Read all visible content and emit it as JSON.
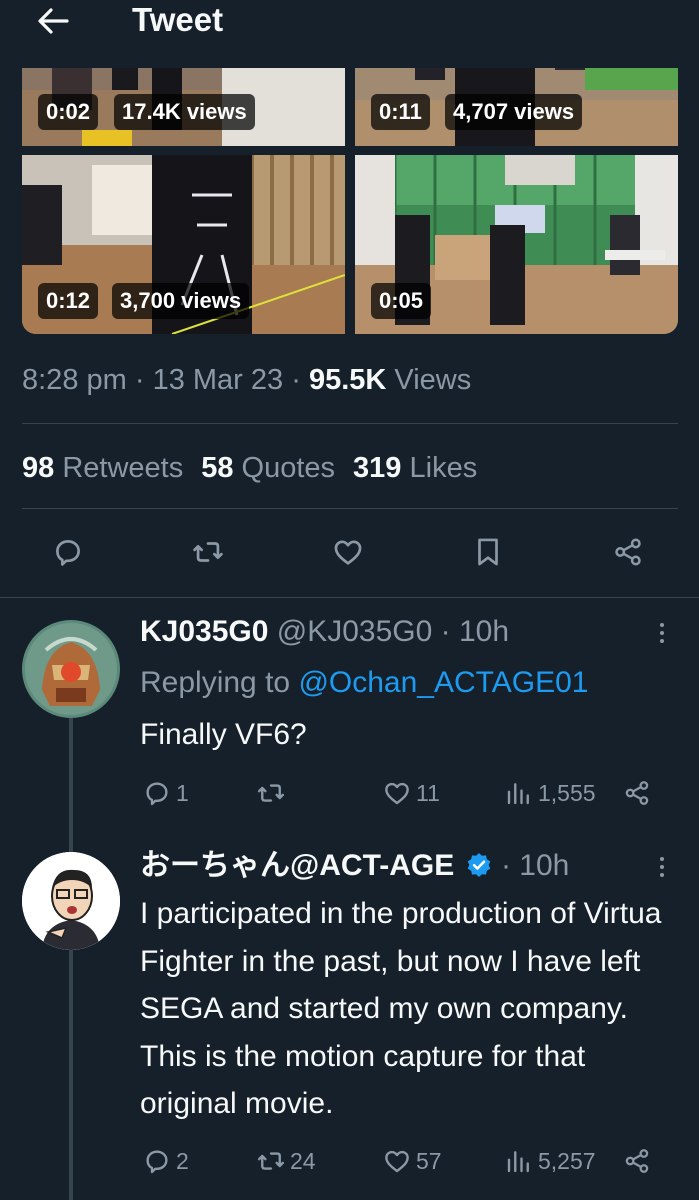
{
  "header": {
    "title": "Tweet",
    "back_icon": "arrow-left-icon"
  },
  "media": [
    {
      "duration": "0:02",
      "views": "17.4K views"
    },
    {
      "duration": "0:11",
      "views": "4,707 views"
    },
    {
      "duration": "0:12",
      "views": "3,700 views"
    },
    {
      "duration": "0:05",
      "views": ""
    }
  ],
  "tweet_meta": {
    "time": "8:28 pm",
    "sep1": " · ",
    "date": "13 Mar 23",
    "sep2": " · ",
    "views_count": "95.5K",
    "views_label": " Views"
  },
  "stats": {
    "retweets_count": "98",
    "retweets_label": " Retweets",
    "quotes_count": "58",
    "quotes_label": " Quotes",
    "likes_count": "319",
    "likes_label": " Likes"
  },
  "actions": [
    "reply-icon",
    "retweet-icon",
    "like-icon",
    "bookmark-icon",
    "share-icon"
  ],
  "replies": [
    {
      "name": "KJ035G0",
      "handle": " @KJ035G0",
      "time": " · 10h",
      "replying_prefix": "Replying to ",
      "replying_to": "@Ochan_ACTAGE01",
      "text": "Finally VF6?",
      "reply_count": "1",
      "retweet_count": "",
      "like_count": "11",
      "view_count": "1,555"
    },
    {
      "name": "おーちゃん@ACT-AGE",
      "handle": "",
      "time": " · 10h",
      "verified": true,
      "text": "I participated in the production of Virtua Fighter in the past, but now I have left SEGA and started my own company.  This is the motion capture for that original movie.",
      "reply_count": "2",
      "retweet_count": "24",
      "like_count": "57",
      "view_count": "5,257"
    }
  ],
  "colors": {
    "background": "#15202b",
    "text": "#f7f9f9",
    "secondary": "#8b98a5",
    "accent": "#1d9bf0",
    "divider": "#38444d"
  }
}
